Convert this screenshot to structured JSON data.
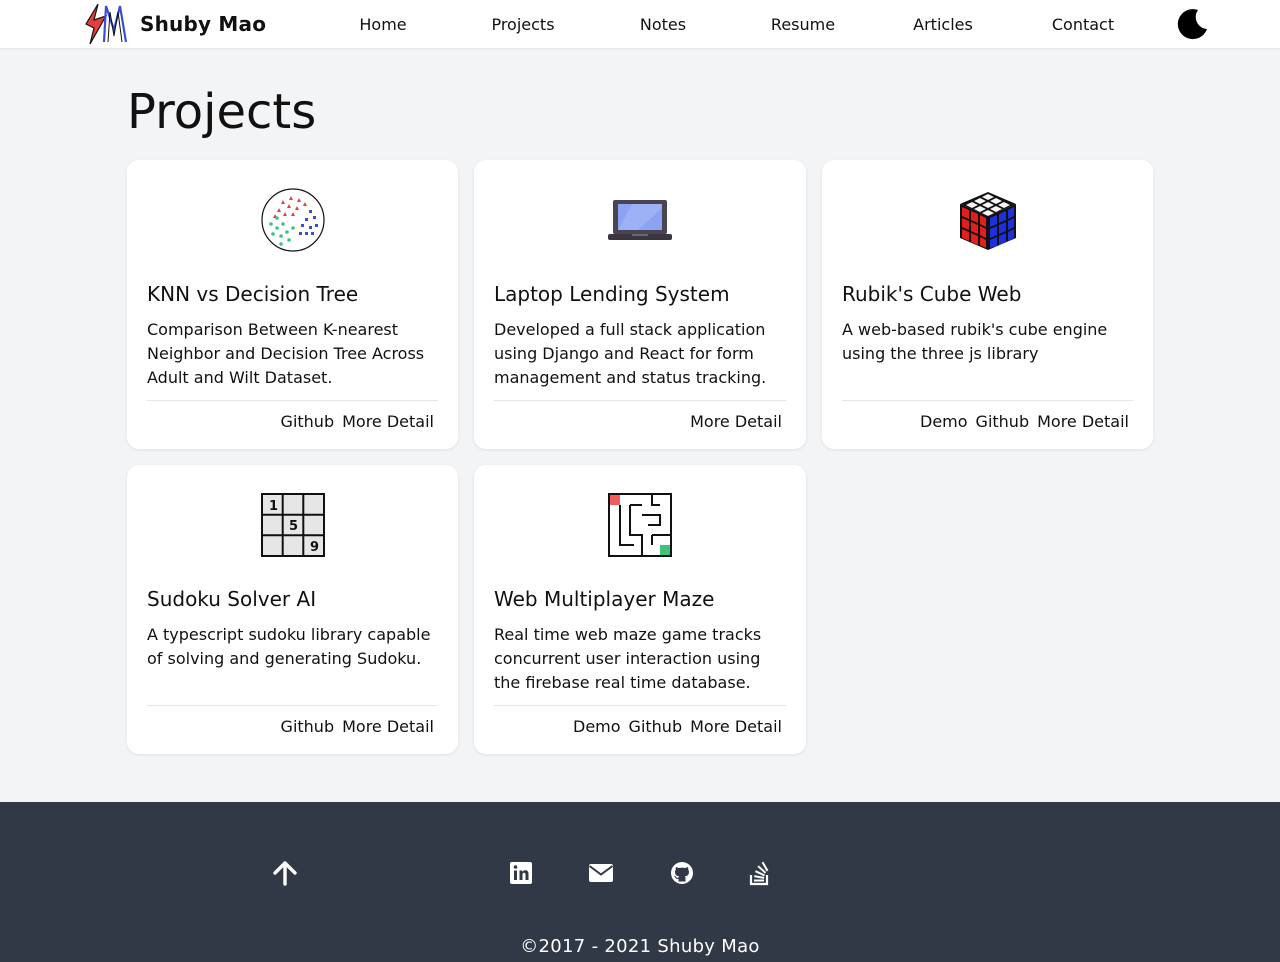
{
  "nav": {
    "brand": "Shuby Mao",
    "links": [
      "Home",
      "Projects",
      "Notes",
      "Resume",
      "Articles",
      "Contact"
    ],
    "theme_icon": "moon-icon"
  },
  "page": {
    "title": "Projects"
  },
  "projects": [
    {
      "icon": "knn-scatter-icon",
      "title": "KNN vs Decision Tree",
      "description": "Comparison Between K-nearest Neighbor and Decision Tree Across Adult and Wilt Dataset.",
      "actions": [
        "Github",
        "More Detail"
      ]
    },
    {
      "icon": "laptop-icon",
      "title": "Laptop Lending System",
      "description": "Developed a full stack application using Django and React for form management and status tracking.",
      "actions": [
        "More Detail"
      ]
    },
    {
      "icon": "rubiks-cube-icon",
      "title": "Rubik's Cube Web",
      "description": "A web-based rubik's cube engine using the three js library",
      "actions": [
        "Demo",
        "Github",
        "More Detail"
      ]
    },
    {
      "icon": "sudoku-grid-icon",
      "title": "Sudoku Solver AI",
      "description": "A typescript sudoku library capable of solving and generating Sudoku.",
      "actions": [
        "Github",
        "More Detail"
      ]
    },
    {
      "icon": "maze-icon",
      "title": "Web Multiplayer Maze",
      "description": "Real time web maze game tracks concurrent user interaction using the firebase real time database.",
      "actions": [
        "Demo",
        "Github",
        "More Detail"
      ]
    }
  ],
  "icon_text": {
    "sudoku_digits": [
      "1",
      "5",
      "9"
    ]
  },
  "footer": {
    "to_top_icon": "arrow-up-icon",
    "social_icons": [
      "linkedin-icon",
      "email-icon",
      "github-icon",
      "stackoverflow-icon"
    ],
    "copyright": "©2017 - 2021 Shuby Mao"
  },
  "colors": {
    "page_bg": "#f3f4f6",
    "card_bg": "#ffffff",
    "footer_bg": "#313846",
    "text": "#111111"
  }
}
